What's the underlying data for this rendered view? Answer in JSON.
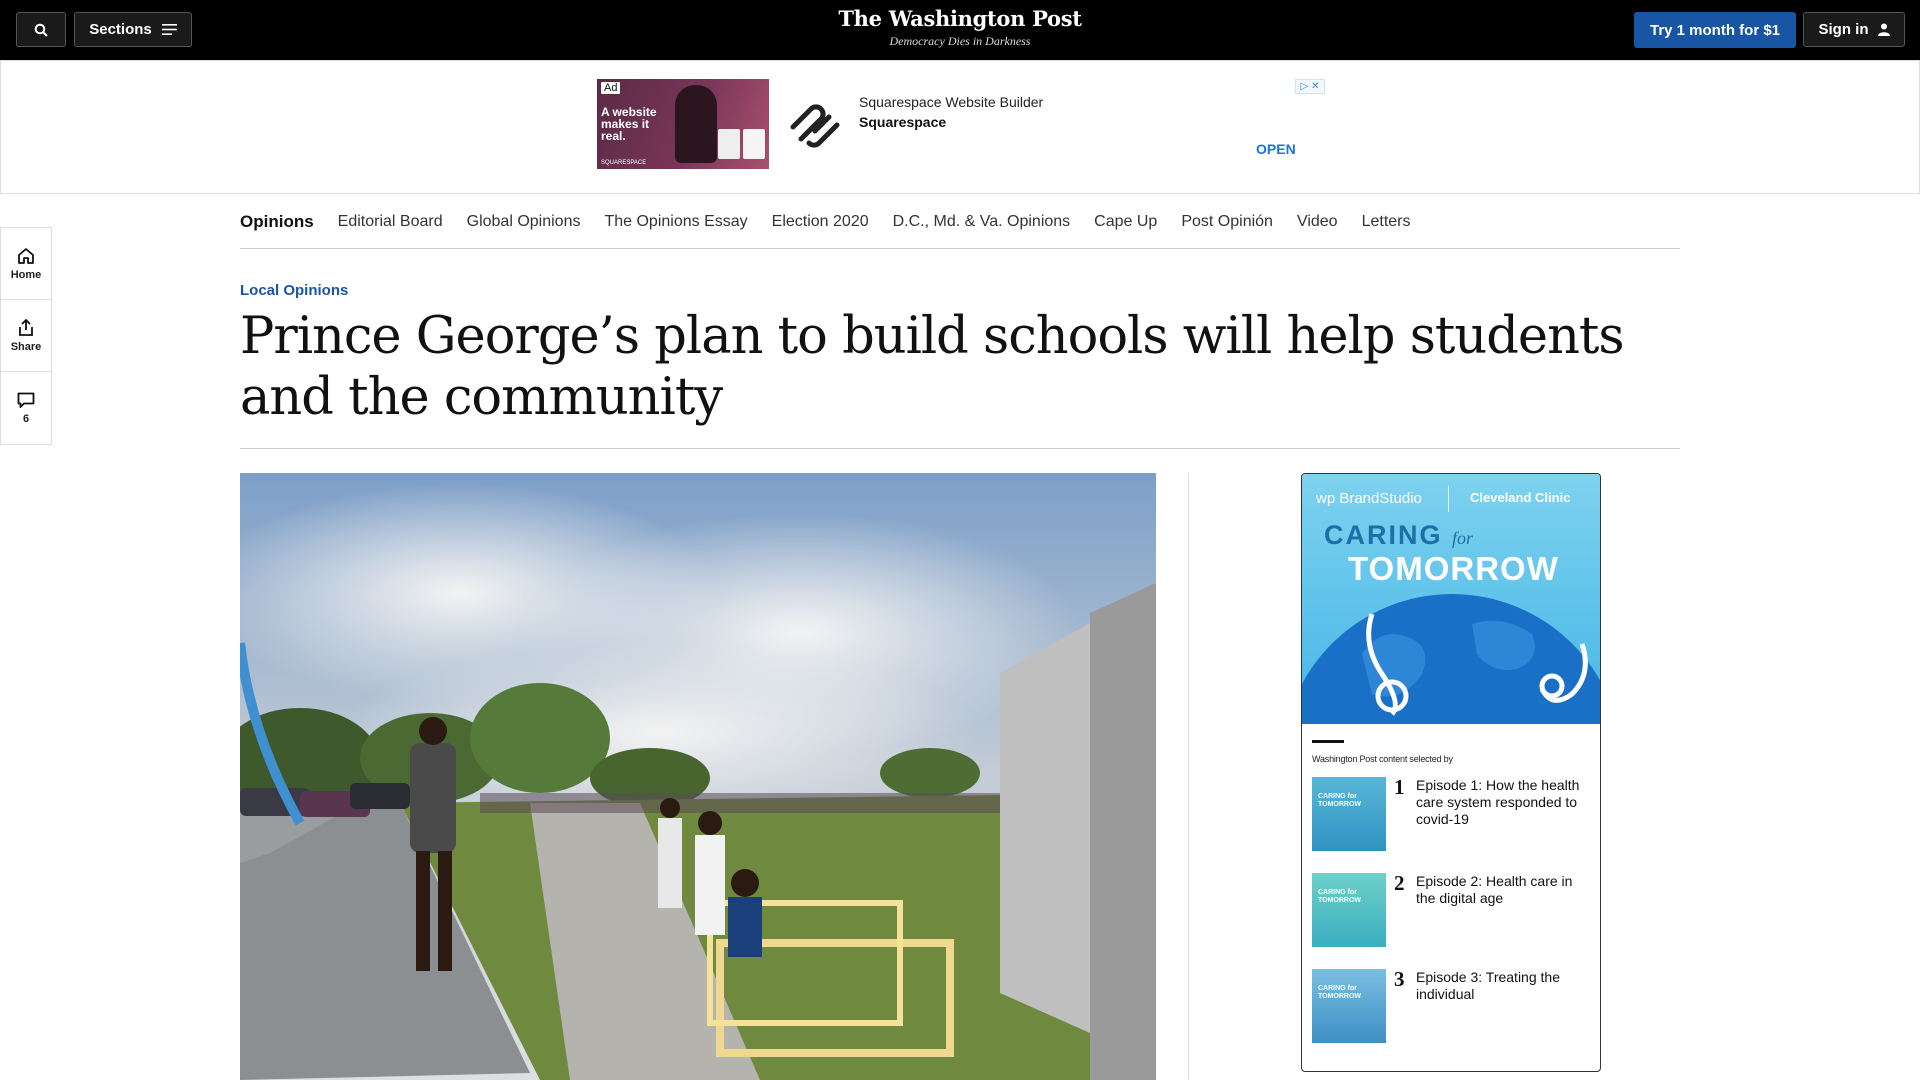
{
  "header": {
    "sections_label": "Sections",
    "logo_name": "The Washington Post",
    "logo_tagline": "Democracy Dies in Darkness",
    "try_label": "Try 1 month for $1",
    "signin_label": "Sign in",
    "icons": {
      "search": "search-icon",
      "menu": "hamburger-icon",
      "user": "user-icon"
    }
  },
  "ad": {
    "badge": "Ad",
    "image_text": "A website makes it real.",
    "image_brand": "SQUARESPACE",
    "title": "Squarespace Website Builder",
    "advertiser": "Squarespace",
    "cta": "OPEN"
  },
  "section_nav": {
    "items": [
      "Opinions",
      "Editorial Board",
      "Global Opinions",
      "The Opinions Essay",
      "Election 2020",
      "D.C., Md. & Va. Opinions",
      "Cape Up",
      "Post Opinión",
      "Video",
      "Letters"
    ]
  },
  "rail": {
    "home_label": "Home",
    "share_label": "Share",
    "comments_count": "6"
  },
  "article": {
    "kicker": "Local Opinions",
    "headline": "Prince George’s plan to build schools will help students and the community"
  },
  "brand_studio": {
    "studio_label": "wp BrandStudio",
    "sponsor": "Cleveland Clinic",
    "title_line1": "CARING",
    "title_for": "for",
    "title_line2": "TOMORROW",
    "selected_by": "Washington Post content selected by",
    "thumb_title": "CARING for TOMORROW",
    "episodes": [
      {
        "num": "1",
        "title": "Episode 1: How the health care system responded to covid-19"
      },
      {
        "num": "2",
        "title": "Episode 2: Health care in the digital age"
      },
      {
        "num": "3",
        "title": "Episode 3: Treating the individual"
      }
    ]
  },
  "colors": {
    "accent_blue": "#1955a5",
    "topbar": "#000000",
    "ad_link": "#1a73e8"
  }
}
